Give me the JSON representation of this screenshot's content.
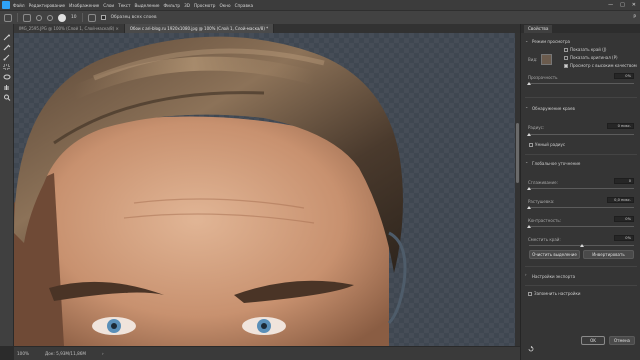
{
  "app": {
    "menu": [
      "Файл",
      "Редактирование",
      "Изображение",
      "Слои",
      "Текст",
      "Выделение",
      "Фильтр",
      "3D",
      "Просмотр",
      "Окно",
      "Справка"
    ],
    "window_controls": [
      "—",
      "□",
      "✕"
    ]
  },
  "options_bar": {
    "sample_all_layers_label": "Образец всех слоев",
    "brush_size": "10",
    "right_label": "Р"
  },
  "tabs": [
    {
      "label": "IMG_2595.JPG @ 100% (Слой 1, Слой-маска/8) ×",
      "active": false
    },
    {
      "label": "Обои с ari-blog.ru 1920x1080.jpg @ 100% (Слой 1, Слой-маска/8) *",
      "active": true
    }
  ],
  "status": {
    "zoom": "100%",
    "doc_info": "Док: 5,93M/11,86M",
    "arrow": "›"
  },
  "panel": {
    "tab_label": "Свойства",
    "view_mode_label": "Режим просмотра",
    "view_label": "Вид:",
    "show_edge": "Показать край (J)",
    "show_original": "Показать оригинал (P)",
    "high_quality": "Просмотр с высоким качеством",
    "opacity_label": "Прозрачность",
    "opacity_value": "0%",
    "edge_detection": "Обнаружение краев",
    "radius_label": "Радиус:",
    "radius_value": "0 пикс.",
    "smart_radius": "Умный радиус",
    "global_refinements": "Глобальное уточнение",
    "smooth_label": "Сглаживание:",
    "smooth_value": "0",
    "feather_label": "Растушевка:",
    "feather_value": "0,0 пикс.",
    "contrast_label": "Контрастность:",
    "contrast_value": "0%",
    "shift_edge_label": "Сместить край:",
    "shift_edge_value": "0%",
    "clear_selection": "Очистить выделение",
    "invert": "Инвертировать",
    "output_settings": "Настройки экспорта",
    "remember_settings": "Запомнить настройки",
    "ok": "OK",
    "cancel": "Отмена",
    "sliders": {
      "opacity": 0.0,
      "smooth": 0.0,
      "feather": 0.0,
      "contrast": 0.0,
      "shift_edge": 0.5
    }
  },
  "colors": {
    "accent": "#2fa3f7",
    "canvas_bg": "#3f4751",
    "panel_bg": "#353535"
  }
}
